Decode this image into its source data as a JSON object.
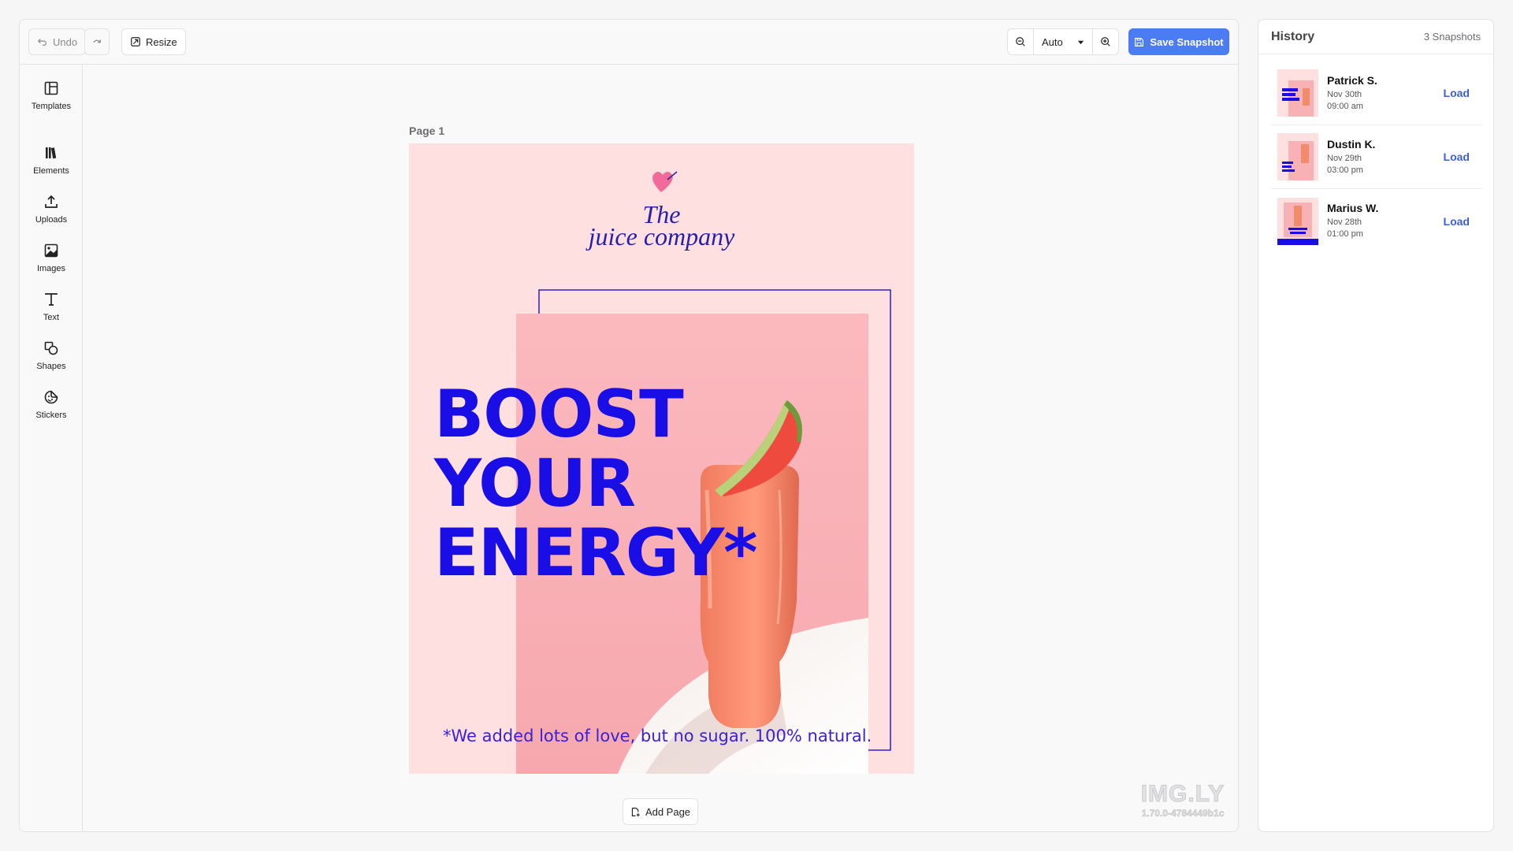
{
  "toolbar": {
    "undo_label": "Undo",
    "resize_label": "Resize",
    "zoom_value": "Auto",
    "save_label": "Save Snapshot"
  },
  "rail": {
    "items": [
      {
        "label": "Templates",
        "icon": "templates-icon"
      },
      {
        "label": "Elements",
        "icon": "elements-icon"
      },
      {
        "label": "Uploads",
        "icon": "upload-icon"
      },
      {
        "label": "Images",
        "icon": "image-icon"
      },
      {
        "label": "Text",
        "icon": "text-icon"
      },
      {
        "label": "Shapes",
        "icon": "shapes-icon"
      },
      {
        "label": "Stickers",
        "icon": "sticker-icon"
      }
    ]
  },
  "canvas": {
    "page_label": "Page 1",
    "add_page_label": "Add Page",
    "poster": {
      "brand_the": "The",
      "brand_name": "juice company",
      "headline": [
        "BOOST",
        "YOUR",
        "ENERGY*"
      ],
      "footnote": "*We added lots of love, but no sugar. 100% natural."
    }
  },
  "watermark": {
    "logo": "IMG.LY",
    "version": "1.70.0-4784449b1c"
  },
  "history": {
    "title": "History",
    "count": "3 Snapshots",
    "load_label": "Load",
    "snapshots": [
      {
        "name": "Patrick S.",
        "date": "Nov 30th",
        "time": "09:00 am"
      },
      {
        "name": "Dustin K.",
        "date": "Nov 29th",
        "time": "03:00 pm"
      },
      {
        "name": "Marius W.",
        "date": "Nov 28th",
        "time": "01:00 pm"
      }
    ]
  },
  "colors": {
    "accent": "#4c7cf3",
    "poster_bg": "#fde0df",
    "headline": "#1a0ee6",
    "brand": "#2a1fa8",
    "load_link": "#3c5fd8"
  }
}
